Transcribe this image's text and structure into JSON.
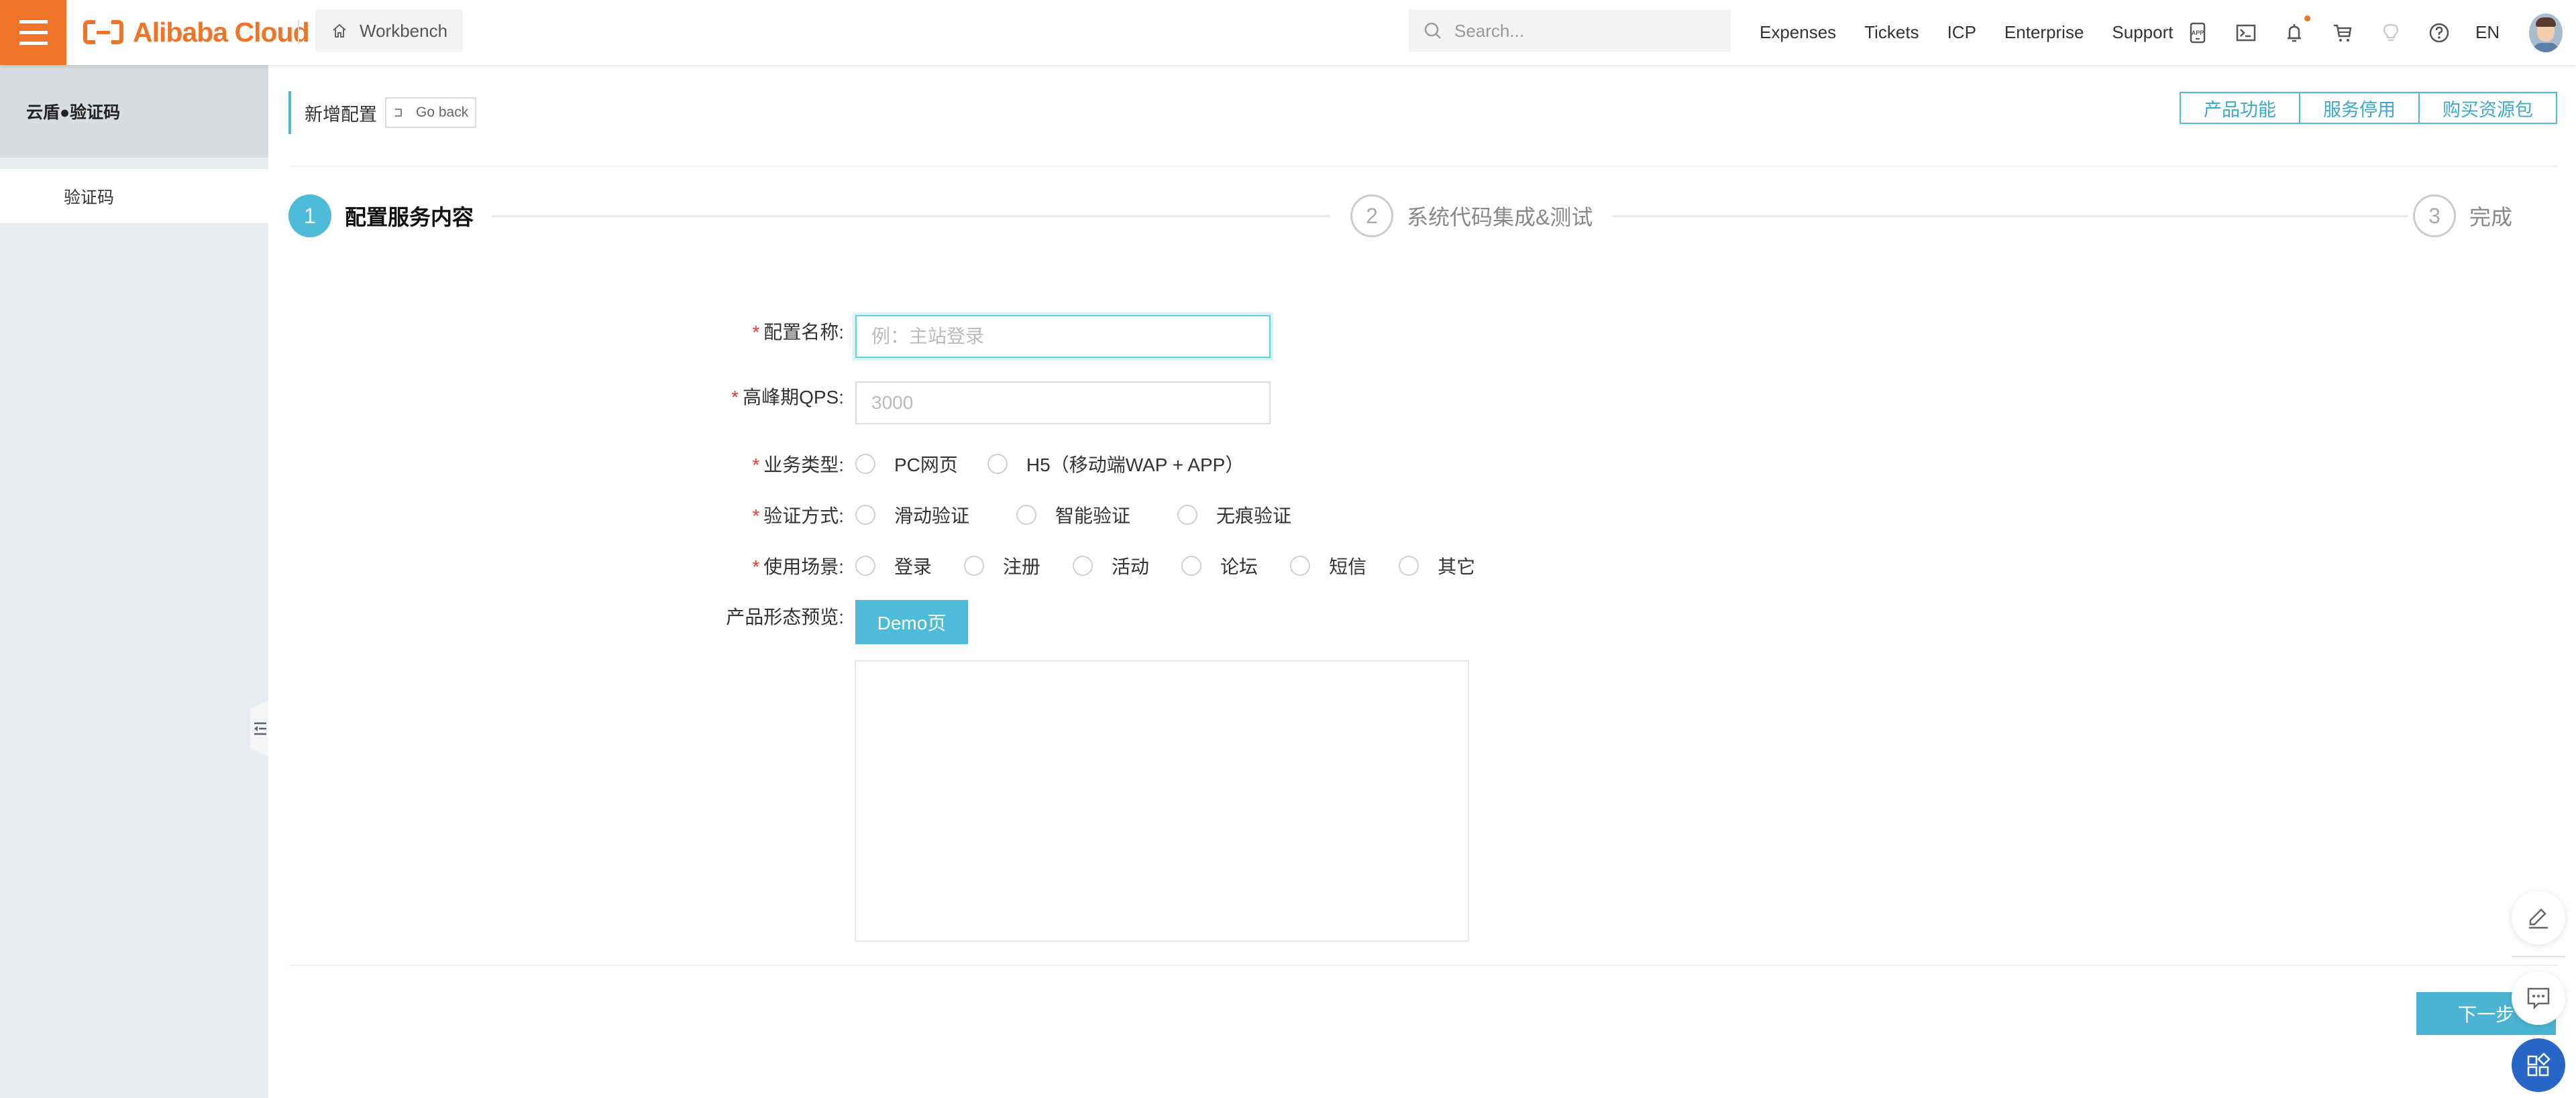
{
  "header": {
    "brand": "Alibaba Cloud",
    "workbench_label": "Workbench",
    "search_placeholder": "Search...",
    "nav_links": [
      "Expenses",
      "Tickets",
      "ICP",
      "Enterprise",
      "Support"
    ],
    "icons": [
      "app-icon",
      "terminal-icon",
      "bell-icon",
      "cart-icon",
      "lightbulb-icon",
      "help-icon"
    ],
    "notification_dot_color": "#f07428",
    "language": "EN"
  },
  "sidebar": {
    "title": "云盾●验证码",
    "items": [
      {
        "label": "验证码"
      }
    ]
  },
  "page": {
    "title": "新增配置",
    "go_back": "Go back",
    "actions": [
      "产品功能",
      "服务停用",
      "购买资源包"
    ]
  },
  "steps": [
    {
      "number": "1",
      "label": "配置服务内容",
      "state": "active"
    },
    {
      "number": "2",
      "label": "系统代码集成&测试",
      "state": "inactive"
    },
    {
      "number": "3",
      "label": "完成",
      "state": "inactive"
    }
  ],
  "form": {
    "config_name": {
      "label": "配置名称:",
      "required": true,
      "value": "",
      "placeholder": "例：主站登录"
    },
    "peak_qps": {
      "label": "高峰期QPS:",
      "required": true,
      "value": "",
      "placeholder": "3000"
    },
    "business_type": {
      "label": "业务类型:",
      "required": true,
      "options": [
        "PC网页",
        "H5（移动端WAP + APP）"
      ],
      "selected": null
    },
    "verify_method": {
      "label": "验证方式:",
      "required": true,
      "options": [
        "滑动验证",
        "智能验证",
        "无痕验证"
      ],
      "selected": null
    },
    "scenario": {
      "label": "使用场景:",
      "required": true,
      "options": [
        "登录",
        "注册",
        "活动",
        "论坛",
        "短信",
        "其它"
      ],
      "selected": null
    },
    "preview": {
      "label": "产品形态预览:",
      "button": "Demo页"
    }
  },
  "footer": {
    "next_label": "下一步"
  },
  "colors": {
    "brand": "#f07428",
    "accent": "#4ebcd9",
    "required": "#e83a30",
    "fab_blue": "#2766c6"
  }
}
